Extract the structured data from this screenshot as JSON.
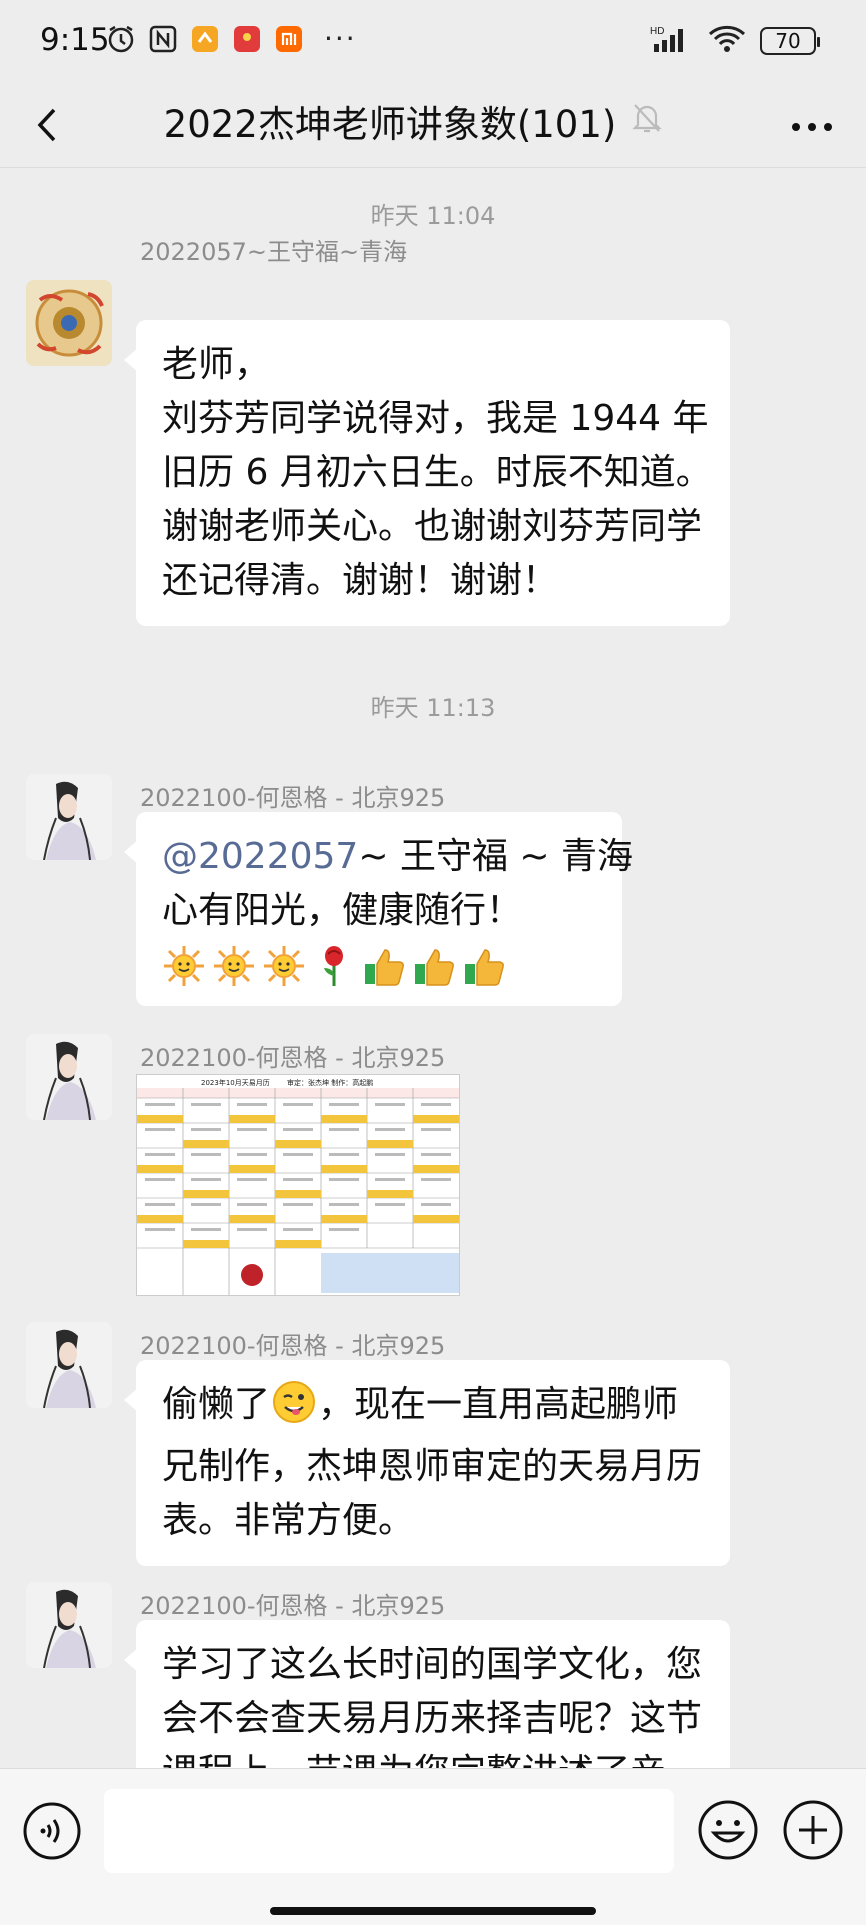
{
  "status_bar": {
    "time": "9:15",
    "battery": "70",
    "network": "HD"
  },
  "header": {
    "title": "2022杰坤老师讲象数(101)"
  },
  "messages": [
    {
      "type": "time",
      "text": "昨天 11:04"
    },
    {
      "type": "text",
      "sender": "2022057~王守福~青海",
      "lines": [
        "老师，",
        "刘芬芳同学说得对，我是 1944 年",
        "旧历 6 月初六日生。时辰不知道。",
        "谢谢老师关心。也谢谢刘芬芳同学",
        "还记得清。谢谢！谢谢！"
      ]
    },
    {
      "type": "time",
      "text": "昨天 11:13"
    },
    {
      "type": "text",
      "sender": "2022100-何恩格 - 北京925",
      "mention": "@2022057",
      "mention_rest": "~ 王守福 ~ 青海",
      "lines": [
        "心有阳光，健康随行！"
      ],
      "emojis": [
        "sun-emoji",
        "sun-emoji",
        "sun-emoji",
        "rose-emoji",
        "thumbs-up-emoji",
        "thumbs-up-emoji",
        "thumbs-up-emoji"
      ]
    },
    {
      "type": "image",
      "sender": "2022100-何恩格 - 北京925",
      "image_title": "2023年10月天易月历",
      "image_subtitle": "审定：张杰坤 制作：高起鹏"
    },
    {
      "type": "text",
      "sender": "2022100-何恩格 - 北京925",
      "lines": [
        "偷懒了",
        "，现在一直用高起鹏师",
        "兄制作，杰坤恩师审定的天易月历",
        "表。非常方便。"
      ]
    },
    {
      "type": "text",
      "sender": "2022100-何恩格 - 北京925",
      "lines": [
        "学习了这么长时间的国学文化，您",
        "会不会查天易月历来择吉呢？这节",
        "课程上，节课为您完整讲述了亲"
      ]
    }
  ],
  "colors": {
    "background": "#ededed",
    "bubble": "#ffffff",
    "mention": "#576b95"
  }
}
